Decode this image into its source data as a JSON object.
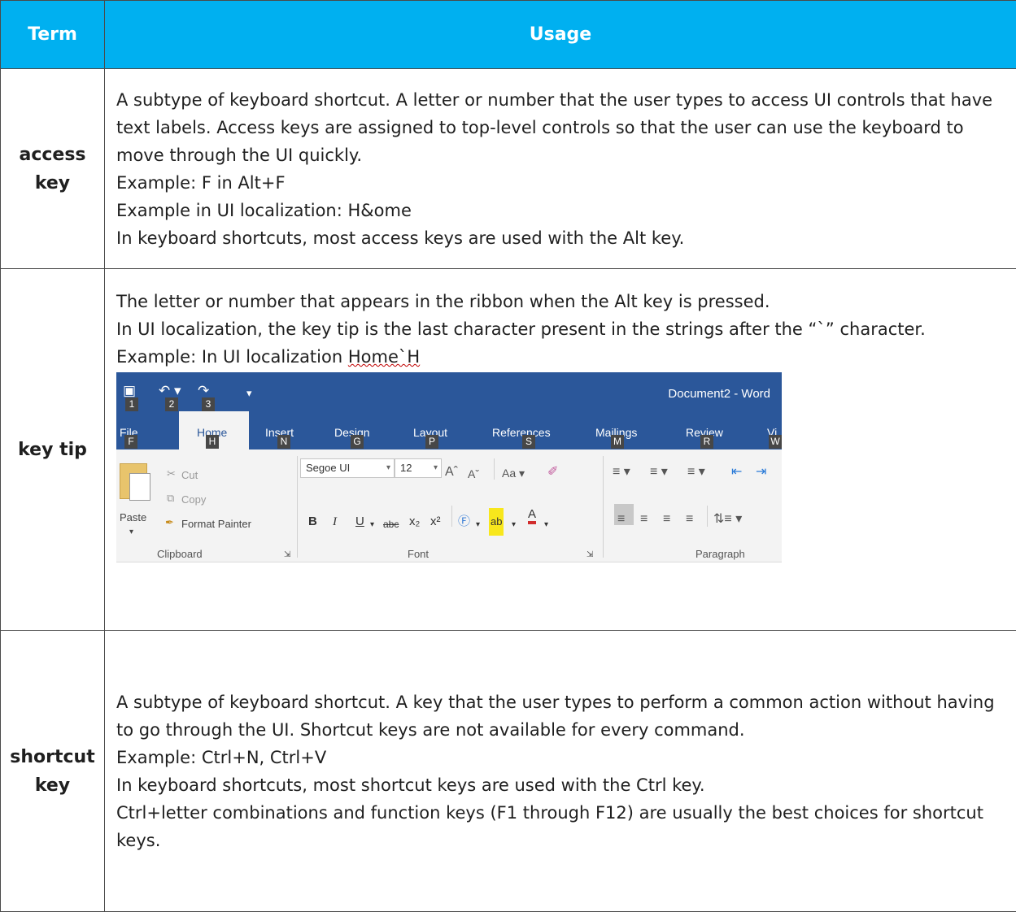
{
  "header": {
    "term": "Term",
    "usage": "Usage"
  },
  "rows": [
    {
      "term": "access key",
      "lines": [
        "A subtype of keyboard shortcut. A letter or number that the user types to access UI controls that have text labels. Access keys are assigned to top-level controls so that the user can use the keyboard to move through the UI quickly.",
        "Example: F in Alt+F",
        "Example in UI localization: H&ome",
        "In keyboard shortcuts, most access keys are used with the Alt key."
      ]
    },
    {
      "term": "key tip",
      "lines": [
        "The letter or number that appears in the ribbon when the Alt key is pressed.",
        "In UI localization, the key tip is the last character present in the strings after the “`” character."
      ],
      "example_prefix": "Example: In UI localization ",
      "example_value": "Home`H"
    },
    {
      "term": "shortcut key",
      "lines": [
        "A subtype of keyboard shortcut. A key that the user types to perform a common action without having to go through the UI. Shortcut keys are not available for every command.",
        "Example: Ctrl+N, Ctrl+V",
        "In keyboard shortcuts, most shortcut keys are used with the Ctrl key.",
        "Ctrl+letter combinations and function keys (F1 through F12) are usually the best choices for shortcut keys."
      ]
    }
  ],
  "ribbon": {
    "doc_title": "Document2 - Word",
    "quick_access_tips": [
      "1",
      "2",
      "3"
    ],
    "tabs": [
      {
        "label": "File",
        "tip": "F"
      },
      {
        "label": "Home",
        "tip": "H"
      },
      {
        "label": "Insert",
        "tip": "N"
      },
      {
        "label": "Design",
        "tip": "G"
      },
      {
        "label": "Layout",
        "tip": "P"
      },
      {
        "label": "References",
        "tip": "S"
      },
      {
        "label": "Mailings",
        "tip": "M"
      },
      {
        "label": "Review",
        "tip": "R"
      },
      {
        "label": "Vi",
        "tip": "W"
      }
    ],
    "clipboard": {
      "paste": "Paste",
      "cut": "Cut",
      "copy": "Copy",
      "format_painter": "Format Painter",
      "group": "Clipboard"
    },
    "font": {
      "name": "Segoe UI",
      "size": "12",
      "change_case": "Aa",
      "group": "Font"
    },
    "paragraph": {
      "group": "Paragraph"
    }
  }
}
